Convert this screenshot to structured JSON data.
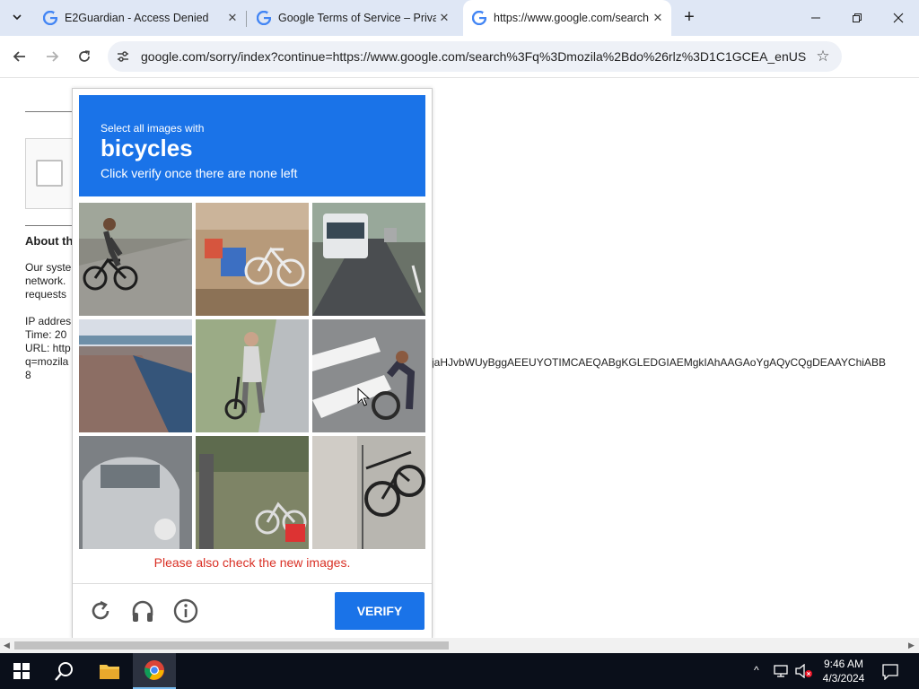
{
  "browser": {
    "tabs": [
      {
        "title": "E2Guardian - Access Denied",
        "active": false
      },
      {
        "title": "Google Terms of Service – Priva",
        "active": false
      },
      {
        "title": "https://www.google.com/search",
        "active": true
      }
    ],
    "address": "google.com/sorry/index?continue=https://www.google.com/search%3Fq%3Dmozila%2Bdo%26rlz%3D1C1GCEA_enUS..."
  },
  "page": {
    "about_title": "About th",
    "paragraph_lines": [
      "Our syste",
      "network.",
      "requests"
    ],
    "ip_lines": [
      "IP addres",
      "Time: 20",
      "URL: http",
      "q=mozila",
      "8"
    ],
    "url_tail": "jaHJvbWUyBggAEEUYOTIMCAEQABgKGLEDGIAEMgkIAhAAGAoYgAQyCQgDEAAYChiABB"
  },
  "captcha": {
    "instruction": "Select all images with",
    "target": "bicycles",
    "subtext": "Click verify once there are none left",
    "error": "Please also check the new images.",
    "verify_label": "VERIFY",
    "tiles": [
      "cyclist on road",
      "bicycle by trash",
      "bus on street",
      "highway",
      "woman with bicycle",
      "cyclist on crosswalk",
      "parked car",
      "bicycle at station",
      "parked bicycles"
    ]
  },
  "taskbar": {
    "time": "9:46 AM",
    "date": "4/3/2024"
  },
  "colors": {
    "accent": "#1a73e8",
    "error": "#d93025",
    "tabstrip": "#dfe7f5"
  }
}
